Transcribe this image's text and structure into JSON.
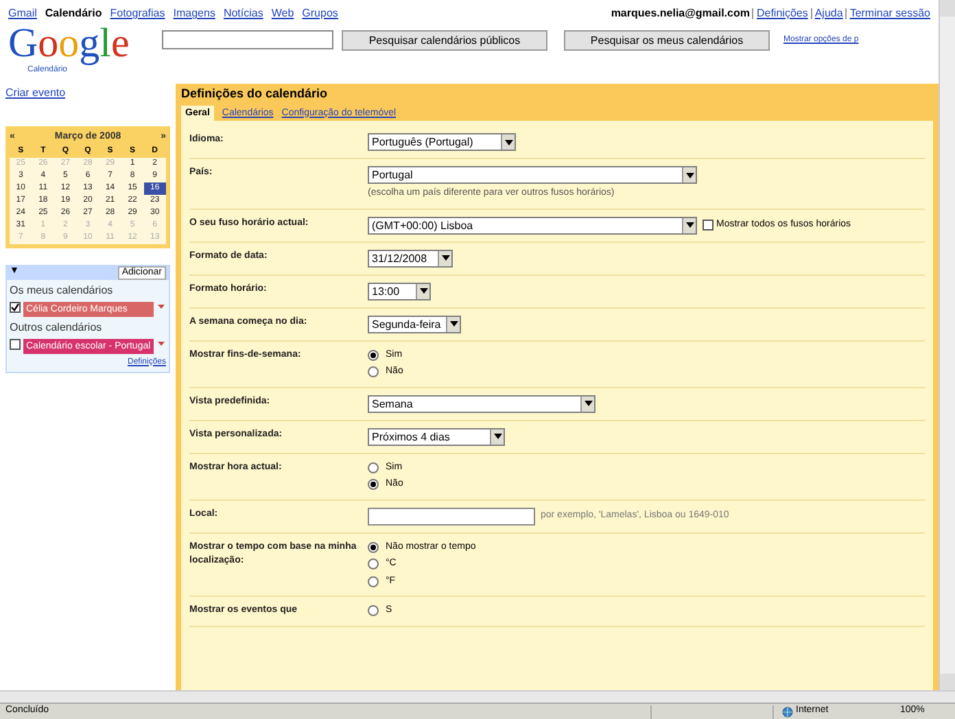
{
  "top_nav": [
    {
      "label": "Gmail",
      "selected": false
    },
    {
      "label": "Calendário",
      "selected": true
    },
    {
      "label": "Fotografias",
      "selected": false
    },
    {
      "label": "Imagens",
      "selected": false
    },
    {
      "label": "Notícias",
      "selected": false
    },
    {
      "label": "Web",
      "selected": false
    },
    {
      "label": "Grupos",
      "selected": false
    }
  ],
  "account": {
    "email": "marques.nelia@gmail.com",
    "links": [
      "Definições",
      "Ajuda",
      "Terminar sessão"
    ]
  },
  "logo": {
    "word": "Google",
    "sub": "Calendário"
  },
  "search": {
    "buttons": [
      "Pesquisar calendários públicos",
      "Pesquisar os meus calendários"
    ],
    "link": "Mostrar opções de p"
  },
  "sidebar": {
    "create": "Criar evento",
    "mini_calendar": {
      "prev": "«",
      "title": "Março de 2008",
      "next": "»",
      "weekdays": [
        "S",
        "T",
        "Q",
        "Q",
        "S",
        "S",
        "D"
      ],
      "weeks": [
        [
          {
            "d": "25",
            "other": true,
            "selected": false
          },
          {
            "d": "26",
            "other": true,
            "selected": false
          },
          {
            "d": "27",
            "other": true,
            "selected": false
          },
          {
            "d": "28",
            "other": true,
            "selected": false
          },
          {
            "d": "29",
            "other": true,
            "selected": false
          },
          {
            "d": "1",
            "other": false,
            "selected": false
          },
          {
            "d": "2",
            "other": false,
            "selected": false
          }
        ],
        [
          {
            "d": "3",
            "other": false,
            "selected": false
          },
          {
            "d": "4",
            "other": false,
            "selected": false
          },
          {
            "d": "5",
            "other": false,
            "selected": false
          },
          {
            "d": "6",
            "other": false,
            "selected": false
          },
          {
            "d": "7",
            "other": false,
            "selected": false
          },
          {
            "d": "8",
            "other": false,
            "selected": false
          },
          {
            "d": "9",
            "other": false,
            "selected": false
          }
        ],
        [
          {
            "d": "10",
            "other": false,
            "selected": false
          },
          {
            "d": "11",
            "other": false,
            "selected": false
          },
          {
            "d": "12",
            "other": false,
            "selected": false
          },
          {
            "d": "13",
            "other": false,
            "selected": false
          },
          {
            "d": "14",
            "other": false,
            "selected": false
          },
          {
            "d": "15",
            "other": false,
            "selected": false
          },
          {
            "d": "16",
            "other": false,
            "selected": true
          }
        ],
        [
          {
            "d": "17",
            "other": false,
            "selected": false
          },
          {
            "d": "18",
            "other": false,
            "selected": false
          },
          {
            "d": "19",
            "other": false,
            "selected": false
          },
          {
            "d": "20",
            "other": false,
            "selected": false
          },
          {
            "d": "21",
            "other": false,
            "selected": false
          },
          {
            "d": "22",
            "other": false,
            "selected": false
          },
          {
            "d": "23",
            "other": false,
            "selected": false
          }
        ],
        [
          {
            "d": "24",
            "other": false,
            "selected": false
          },
          {
            "d": "25",
            "other": false,
            "selected": false
          },
          {
            "d": "26",
            "other": false,
            "selected": false
          },
          {
            "d": "27",
            "other": false,
            "selected": false
          },
          {
            "d": "28",
            "other": false,
            "selected": false
          },
          {
            "d": "29",
            "other": false,
            "selected": false
          },
          {
            "d": "30",
            "other": false,
            "selected": false
          }
        ],
        [
          {
            "d": "31",
            "other": false,
            "selected": false
          },
          {
            "d": "1",
            "other": true,
            "selected": false
          },
          {
            "d": "2",
            "other": true,
            "selected": false
          },
          {
            "d": "3",
            "other": true,
            "selected": false
          },
          {
            "d": "4",
            "other": true,
            "selected": false
          },
          {
            "d": "5",
            "other": true,
            "selected": false
          },
          {
            "d": "6",
            "other": true,
            "selected": false
          }
        ],
        [
          {
            "d": "7",
            "other": true,
            "selected": false
          },
          {
            "d": "8",
            "other": true,
            "selected": false
          },
          {
            "d": "9",
            "other": true,
            "selected": false
          },
          {
            "d": "10",
            "other": true,
            "selected": false
          },
          {
            "d": "11",
            "other": true,
            "selected": false
          },
          {
            "d": "12",
            "other": true,
            "selected": false
          },
          {
            "d": "13",
            "other": true,
            "selected": false
          }
        ]
      ]
    },
    "collapse": "▼",
    "add": "Adicionar",
    "groups": [
      {
        "title": "Os meus calendários",
        "calendars": [
          {
            "name": "Célia Cordeiro Marques",
            "checked": true,
            "color": "#d96666"
          }
        ]
      },
      {
        "title": "Outros calendários",
        "calendars": [
          {
            "name": "Calendário escolar - Portugal",
            "checked": false,
            "color": "#d6336c"
          }
        ]
      }
    ],
    "footer": "Definições"
  },
  "settings": {
    "title": "Definições do calendário",
    "tabs": [
      {
        "label": "Geral",
        "selected": true
      },
      {
        "label": "Calendários",
        "selected": false
      },
      {
        "label": "Configuração do telemóvel",
        "selected": false
      }
    ],
    "rows": [
      {
        "kind": "select",
        "label": "Idioma:",
        "value": "Português (Portugal)"
      },
      {
        "kind": "select",
        "label": "País:",
        "value": "Portugal",
        "hint": "(escolha um país diferente para ver outros fusos horários)"
      },
      {
        "kind": "select",
        "label": "O seu fuso horário actual:",
        "value": "(GMT+00:00) Lisboa",
        "checkbox": {
          "label": "Mostrar todos os fusos horários",
          "checked": false
        }
      },
      {
        "kind": "select",
        "label": "Formato de data:",
        "value": "31/12/2008"
      },
      {
        "kind": "select",
        "label": "Formato horário:",
        "value": "13:00"
      },
      {
        "kind": "select",
        "label": "A semana começa no dia:",
        "value": "Segunda-feira"
      },
      {
        "kind": "radio",
        "label": "Mostrar fins-de-semana:",
        "options": [
          {
            "label": "Sim",
            "selected": true
          },
          {
            "label": "Não",
            "selected": false
          }
        ]
      },
      {
        "kind": "select",
        "label": "Vista predefinida:",
        "value": "Semana"
      },
      {
        "kind": "select",
        "label": "Vista personalizada:",
        "value": "Próximos 4 dias"
      },
      {
        "kind": "radio",
        "label": "Mostrar hora actual:",
        "options": [
          {
            "label": "Sim",
            "selected": false
          },
          {
            "label": "Não",
            "selected": true
          }
        ]
      },
      {
        "kind": "input",
        "label": "Local:",
        "hint": "por exemplo, 'Lamelas', Lisboa ou 1649-010"
      },
      {
        "kind": "radio",
        "label": "Mostrar o tempo com base na minha localização:",
        "options": [
          {
            "label": "Não mostrar o tempo",
            "selected": true
          },
          {
            "label": "°C",
            "selected": false
          },
          {
            "label": "°F",
            "selected": false
          }
        ]
      },
      {
        "kind": "radio",
        "label": "Mostrar os eventos que",
        "options": [
          {
            "label": "S",
            "selected": false
          }
        ]
      }
    ]
  },
  "status_bar": {
    "text": "Concluído",
    "zone": "Internet",
    "zoom": "100%"
  }
}
